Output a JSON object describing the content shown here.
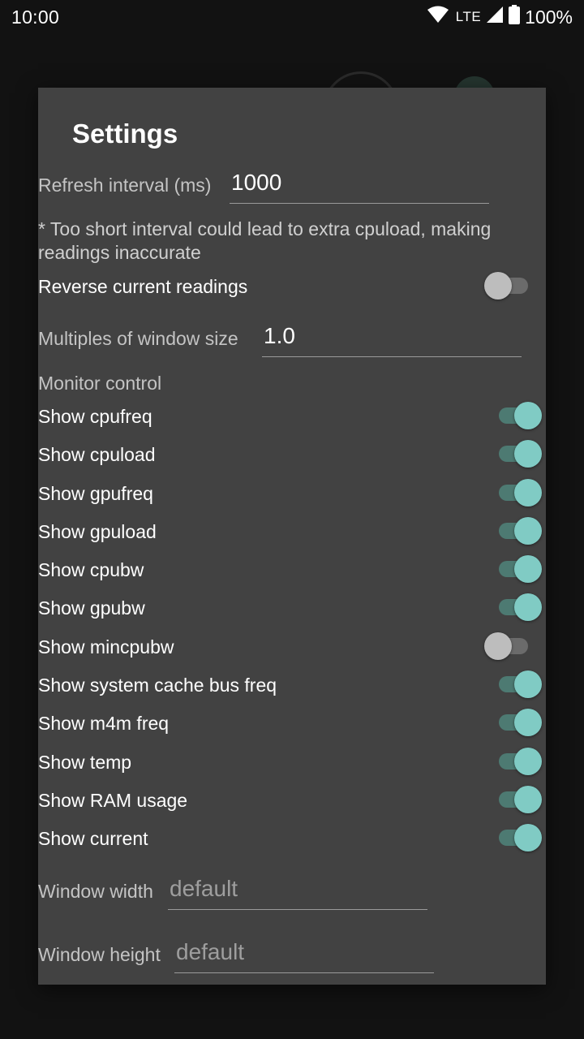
{
  "status_bar": {
    "time": "10:00",
    "network": "LTE",
    "battery": "100%",
    "icons": [
      "wifi-icon",
      "cell-signal-icon",
      "battery-icon"
    ]
  },
  "colors": {
    "dialog_bg": "#424242",
    "accent": "#80cbc4",
    "switch_off": "#bdbdbd"
  },
  "dialog": {
    "title": "Settings",
    "refresh_interval": {
      "label": "Refresh interval (ms)",
      "value": "1000"
    },
    "refresh_note": "* Too short interval could lead to extra cpuload, making readings inaccurate",
    "reverse_current": {
      "label": "Reverse current readings",
      "on": false
    },
    "window_multiple": {
      "label": "Multiples of window size",
      "value": "1.0"
    },
    "monitor_control_label": "Monitor control",
    "monitors": [
      {
        "label": "Show cpufreq",
        "on": true
      },
      {
        "label": "Show cpuload",
        "on": true
      },
      {
        "label": "Show gpufreq",
        "on": true
      },
      {
        "label": "Show gpuload",
        "on": true
      },
      {
        "label": "Show cpubw",
        "on": true
      },
      {
        "label": "Show gpubw",
        "on": true
      },
      {
        "label": "Show mincpubw",
        "on": false
      },
      {
        "label": "Show system cache bus freq",
        "on": true
      },
      {
        "label": "Show m4m freq",
        "on": true
      },
      {
        "label": "Show temp",
        "on": true
      },
      {
        "label": "Show RAM usage",
        "on": true
      },
      {
        "label": "Show current",
        "on": true
      }
    ],
    "window_width": {
      "label": "Window width",
      "placeholder": "default"
    },
    "window_height": {
      "label": "Window height",
      "placeholder": "default"
    }
  }
}
